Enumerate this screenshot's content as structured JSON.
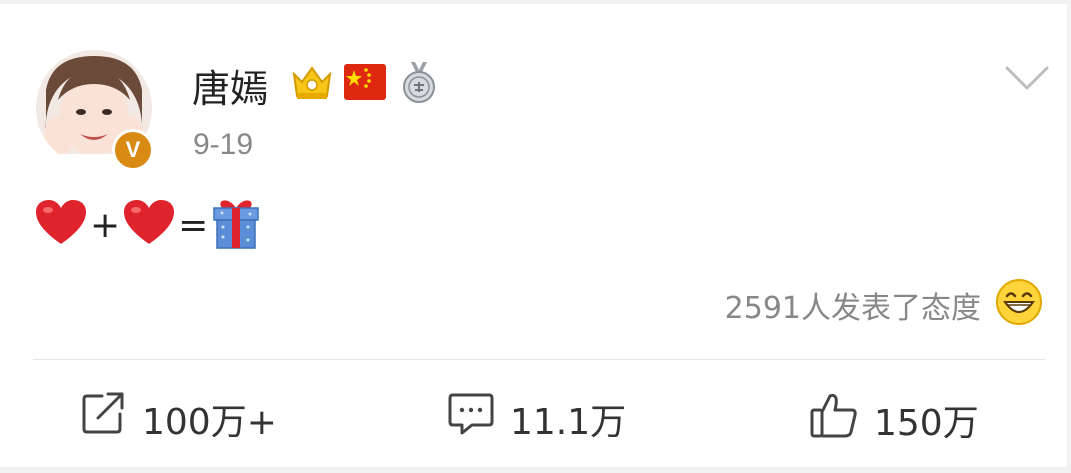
{
  "post": {
    "username": "唐嫣",
    "timestamp": "9-19",
    "verified_badge": "V",
    "badges": [
      "crown-icon",
      "china-flag-icon",
      "medal-icon"
    ],
    "content": {
      "emoji_sequence": [
        "red-heart-icon",
        "+",
        "red-heart-icon",
        "=",
        "gift-box-icon"
      ],
      "plus": "+",
      "equals": "="
    },
    "reaction_summary": "2591人发表了态度",
    "reaction_icon": "grinning-face-icon"
  },
  "actions": {
    "repost_count": "100万+",
    "comment_count": "11.1万",
    "like_count": "150万"
  },
  "colors": {
    "heart": "#e0242e",
    "badge_v": "#d88a12",
    "gift_box": "#5a8fd8",
    "muted_text": "#888888"
  }
}
